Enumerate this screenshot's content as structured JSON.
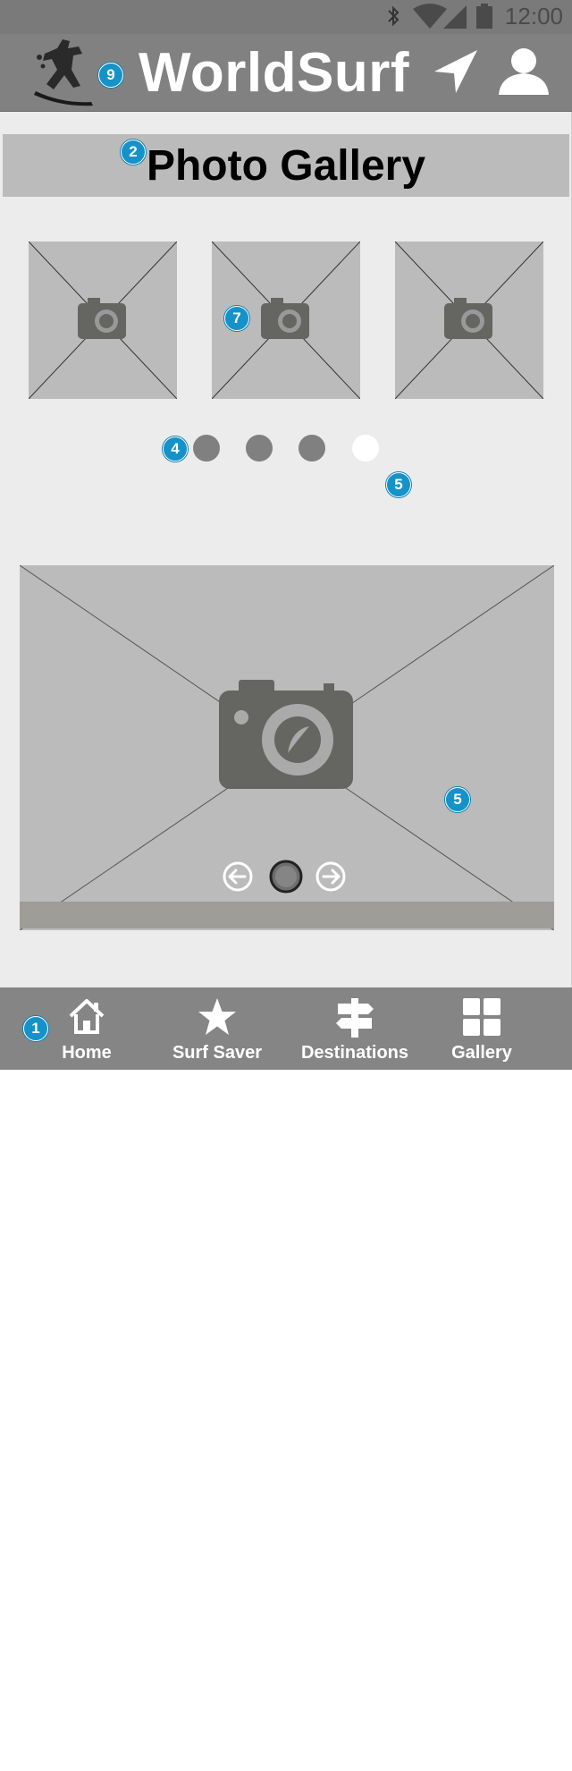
{
  "status_bar": {
    "time": "12:00",
    "icons": [
      "bluetooth-icon",
      "wifi-icon",
      "signal-icon",
      "battery-icon"
    ]
  },
  "app_bar": {
    "title": "WorldSurf",
    "logo_icon": "surfer-logo-icon",
    "actions": [
      "navigation-arrow-icon",
      "user-icon"
    ]
  },
  "section": {
    "title": "Photo Gallery"
  },
  "annotations": {
    "app_bar": "9",
    "section_title": "2",
    "thumbnail": "7",
    "pager_dots": "4",
    "pager_active": "5",
    "main_image": "5",
    "bottom_nav": "1"
  },
  "thumbnails": [
    {
      "icon": "camera-icon"
    },
    {
      "icon": "camera-icon"
    },
    {
      "icon": "camera-icon"
    }
  ],
  "pager": {
    "count": 4,
    "active_index": 3
  },
  "main_image": {
    "icon": "camera-icon",
    "controls": [
      "arrow-left-icon",
      "circle-button-icon",
      "arrow-right-icon"
    ]
  },
  "bottom_nav": {
    "tabs": [
      {
        "label": "Home",
        "icon": "home-icon"
      },
      {
        "label": "Surf Saver",
        "icon": "star-icon"
      },
      {
        "label": "Destinations",
        "icon": "signpost-icon"
      },
      {
        "label": "Gallery",
        "icon": "grid-icon"
      }
    ]
  },
  "colors": {
    "status_bar": "#7a7a7a",
    "app_bar": "#818181",
    "page_bg": "#ececec",
    "placeholder": "#bbbbbb",
    "badge": "#1592c8",
    "bottom_nav": "#858585"
  }
}
